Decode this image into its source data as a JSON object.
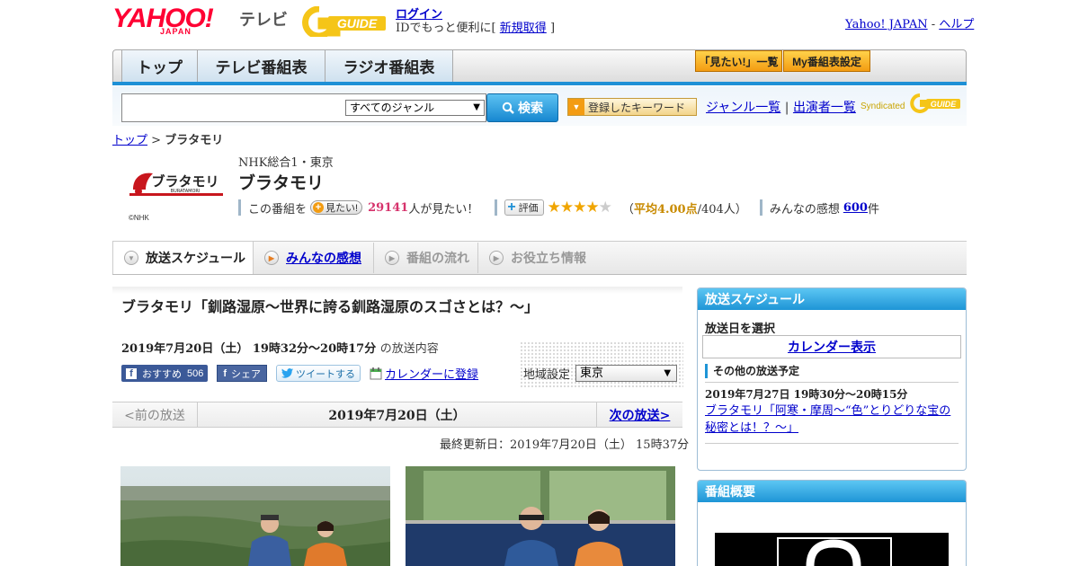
{
  "header": {
    "logo_yahoo": "YAHOO!",
    "logo_japan": "JAPAN",
    "logo_tv": "テレビ",
    "logo_gguide": "GUIDE",
    "login": "ログイン",
    "id_prefix": "IDでもっと便利に[",
    "signup": "新規取得",
    "id_suffix": "]",
    "yahoo_japan_link": "Yahoo! JAPAN",
    "link_sep": "-",
    "help_link": "ヘルプ"
  },
  "nav": {
    "tabs": [
      "トップ",
      "テレビ番組表",
      "ラジオ番組表"
    ],
    "mitai_list": "「見たい!」一覧",
    "my_schedule": "My番組表設定"
  },
  "search": {
    "genre_selected": "すべてのジャンル",
    "button": "検索",
    "keyword_button": "登録したキーワード",
    "genre_list": "ジャンル一覧",
    "sep": "|",
    "performer_list": "出演者一覧",
    "syndicated": "Syndicated"
  },
  "breadcrumb": {
    "top": "トップ",
    "sep": ">",
    "current": "ブラタモリ"
  },
  "program": {
    "logo_text": "ブラタモリ",
    "logo_sub": "BURATAMORI",
    "copyright": "©NHK",
    "channel": "NHK総合1・東京",
    "title": "ブラタモリ",
    "kono_bangumi": "この番組を",
    "mitai_btn": "見たい!",
    "mitai_count": "29141",
    "mitai_suffix": "人が見たい！",
    "hyouka_btn": "評価",
    "stars": 4,
    "avg_open": "（",
    "avg_value": "平均4.00点",
    "avg_suffix": "/404人）",
    "kansou_label": "みんなの感想",
    "kansou_count": "600",
    "kansou_suffix": "件"
  },
  "subnav": {
    "tabs": [
      "放送スケジュール",
      "みんなの感想",
      "番組の流れ",
      "お役立ち情報"
    ]
  },
  "episode": {
    "title": "ブラタモリ「釧路湿原～世界に誇る釧路湿原のスゴさとは？～」",
    "date": "2019年7月20日（土） 19時32分～20時17分",
    "date_suffix": "の放送内容",
    "fb_recommend": "おすすめ",
    "fb_count": "506",
    "fb_share": "シェア",
    "tweet": "ツイートする",
    "calendar_add": "カレンダーに登録",
    "region_label": "地域設定",
    "region_value": "東京",
    "prev": "<前の放送",
    "current_date": "2019年7月20日（土）",
    "next": "次の放送>",
    "updated": "最終更新日：2019年7月20日（土） 15時37分"
  },
  "sidebar": {
    "schedule_title": "放送スケジュール",
    "select_date": "放送日を選択",
    "calendar_display": "カレンダー表示",
    "other_schedule": "その他の放送予定",
    "next_date": "2019年7月27日 19時30分～20時15分",
    "next_title": "ブラタモリ「阿寒・摩周～“色”とりどりな宝の秘密とは！？～」",
    "overview_title": "番組概要"
  },
  "colors": {
    "accent_blue": "#1e95d6",
    "yahoo_red": "#ff0033",
    "orange": "#f39c12",
    "link": "#0000cc"
  }
}
